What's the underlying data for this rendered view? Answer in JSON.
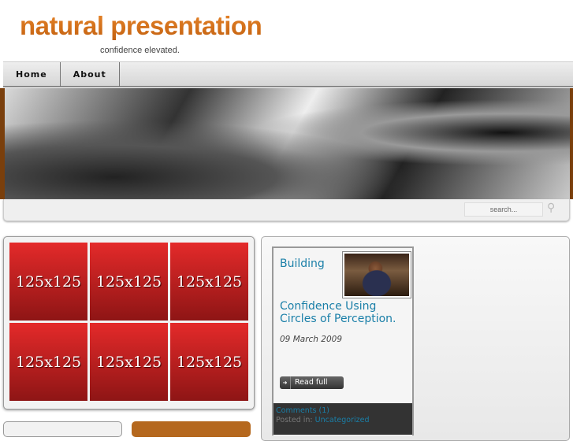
{
  "header": {
    "title": "natural presentation",
    "tagline": "confidence elevated."
  },
  "nav": {
    "items": [
      {
        "label": "Home"
      },
      {
        "label": "About"
      }
    ]
  },
  "search": {
    "placeholder": "search..."
  },
  "ads": [
    "125x125",
    "125x125",
    "125x125",
    "125x125",
    "125x125",
    "125x125"
  ],
  "post": {
    "title_line1": "Building",
    "title_line2": "Confidence Using Circles of Perception.",
    "date": "09 March 2009",
    "read_more": "Read full",
    "comments": "Comments (1)",
    "posted_in_label": "Posted in:",
    "category": "Uncategorized"
  }
}
